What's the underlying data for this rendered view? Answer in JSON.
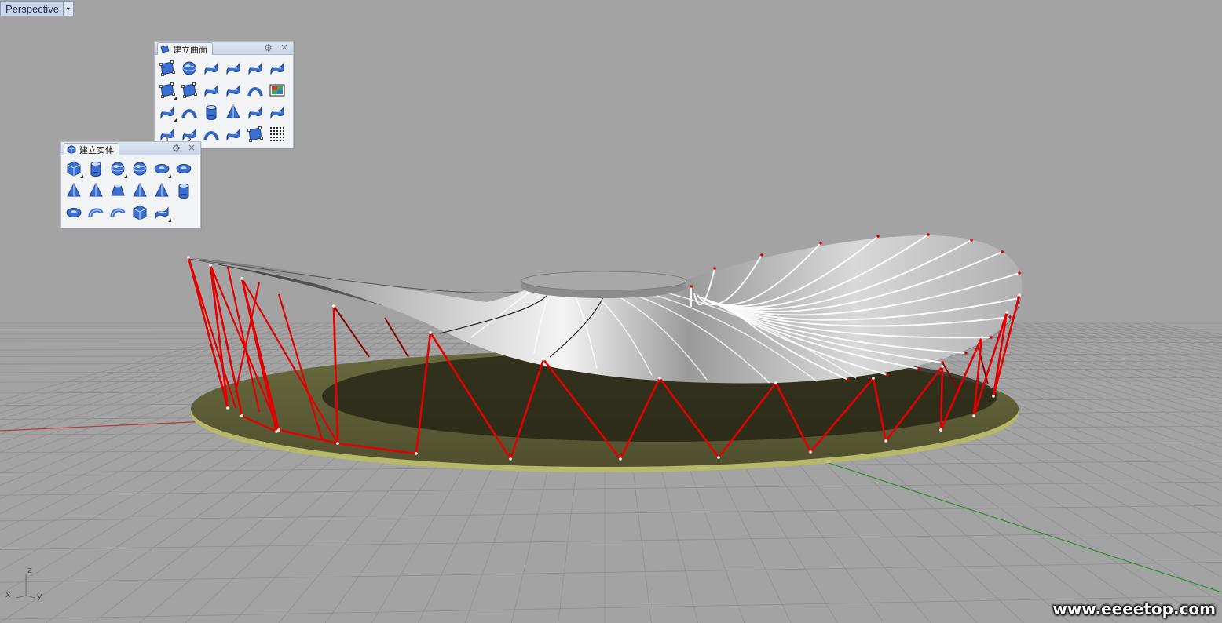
{
  "viewport": {
    "title": "Perspective",
    "menu_arrow": "▾"
  },
  "surface_panel": {
    "title": "建立曲面",
    "gear": "⚙",
    "close": "×",
    "tools": [
      {
        "name": "surface-from-corner-points-icon",
        "flyout": false
      },
      {
        "name": "surface-sphere-icon",
        "flyout": false
      },
      {
        "name": "surface-network-icon",
        "flyout": false
      },
      {
        "name": "surface-loft-icon",
        "flyout": false
      },
      {
        "name": "surface-extrude-icon",
        "flyout": false
      },
      {
        "name": "surface-sweep-icon",
        "flyout": false
      },
      {
        "name": "surface-rectangle-plane-icon",
        "flyout": true
      },
      {
        "name": "surface-vertical-plane-icon",
        "flyout": false
      },
      {
        "name": "surface-edge-curves-icon",
        "flyout": false
      },
      {
        "name": "surface-patch-icon",
        "flyout": false
      },
      {
        "name": "surface-blend-icon",
        "flyout": false
      },
      {
        "name": "surface-heightfield-icon",
        "flyout": false
      },
      {
        "name": "surface-extrude-straight-icon",
        "flyout": true
      },
      {
        "name": "surface-rail-revolve-icon",
        "flyout": false
      },
      {
        "name": "surface-tube-icon",
        "flyout": false
      },
      {
        "name": "surface-cone-icon",
        "flyout": false
      },
      {
        "name": "surface-curve-network-icon",
        "flyout": false
      },
      {
        "name": "surface-drape-icon",
        "flyout": false
      },
      {
        "name": "surface-sweep-1-rail-icon",
        "flyout": false,
        "num": "1"
      },
      {
        "name": "surface-sweep-2-rail-icon",
        "flyout": false,
        "num": "2"
      },
      {
        "name": "surface-revolve-icon",
        "flyout": false
      },
      {
        "name": "surface-loft-shape-icon",
        "flyout": false
      },
      {
        "name": "surface-plane-through-points-icon",
        "flyout": false
      },
      {
        "name": "surface-point-grid-icon",
        "flyout": false
      }
    ]
  },
  "solid_panel": {
    "title": "建立实体",
    "gear": "⚙",
    "close": "×",
    "tools": [
      {
        "name": "solid-box-icon",
        "flyout": true
      },
      {
        "name": "solid-cylinder-icon",
        "flyout": false
      },
      {
        "name": "solid-sphere-icon",
        "flyout": true
      },
      {
        "name": "solid-sphere-arc-icon",
        "flyout": false
      },
      {
        "name": "solid-ellipsoid-icon",
        "flyout": true
      },
      {
        "name": "solid-paraboloid-icon",
        "flyout": false
      },
      {
        "name": "solid-truncated-cone-icon",
        "flyout": false
      },
      {
        "name": "solid-cone-icon",
        "flyout": false
      },
      {
        "name": "solid-frustum-icon",
        "flyout": false
      },
      {
        "name": "solid-pyramid-icon",
        "flyout": false
      },
      {
        "name": "solid-truncated-pyramid-icon",
        "flyout": false
      },
      {
        "name": "solid-tube-icon",
        "flyout": false
      },
      {
        "name": "solid-torus-icon",
        "flyout": false
      },
      {
        "name": "solid-pipe-icon",
        "flyout": false
      },
      {
        "name": "solid-pipe-open-icon",
        "flyout": false
      },
      {
        "name": "solid-extrude-surface-icon",
        "flyout": false
      },
      {
        "name": "solid-extrude-planar-icon",
        "flyout": true
      }
    ]
  },
  "axis": {
    "z": "z",
    "x": "x",
    "y": "y"
  },
  "watermark": "www.eeeetop.com",
  "colors": {
    "background": "#a3a3a3",
    "grid_line": "#8f8f8f",
    "x_axis": "#b33a3a",
    "y_axis": "#2f8f2f",
    "truss": "#e30000",
    "base_plate": "#5e5e38",
    "roof_surface": "#d8d8d8",
    "panel_head": "#c7d4e8",
    "icon_blue": "#3b6fd1"
  }
}
